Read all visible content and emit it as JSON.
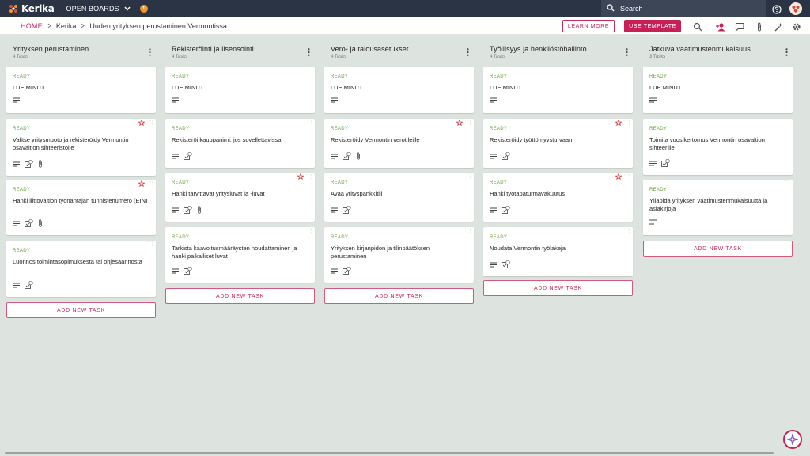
{
  "app": {
    "brand": "Kerika",
    "open_boards": "OPEN BOARDS",
    "notify_count": "1",
    "search_label": "Search"
  },
  "breadcrumb": {
    "home": "HOME",
    "workspace": "Kerika",
    "board": "Uuden yrityksen perustaminen Vermontissa"
  },
  "actions": {
    "learn_more": "LEARN MORE",
    "use_template": "USE TEMPLATE"
  },
  "add_task_label": "ADD NEW TASK",
  "columns": [
    {
      "title": "Yrityksen perustaminen",
      "count": "4 Tasks",
      "cards": [
        {
          "status": "READY",
          "title": "LUE MINUT"
        },
        {
          "status": "READY",
          "title": "Valitse yritysmuoto ja rekisteröidy Vermontin osavaltion sihteeristölle"
        },
        {
          "status": "READY",
          "title": "Hanki liittovaltion työnantajan tunnistenumero (EIN)"
        },
        {
          "status": "READY",
          "title": "Luonnos toimintasopimuksesta tai ohjesäännöstä"
        }
      ]
    },
    {
      "title": "Rekisteröinti ja lisensointi",
      "count": "4 Tasks",
      "cards": [
        {
          "status": "READY",
          "title": "LUE MINUT"
        },
        {
          "status": "READY",
          "title": "Rekisteröi kauppanimi, jos sovellettavissa"
        },
        {
          "status": "READY",
          "title": "Hanki tarvittavat yritysluvat ja -luvat"
        },
        {
          "status": "READY",
          "title": "Tarkista kaavoitusmääräysten noudattaminen ja hanki paikalliset luvat"
        }
      ]
    },
    {
      "title": "Vero- ja talousasetukset",
      "count": "4 Tasks",
      "cards": [
        {
          "status": "READY",
          "title": "LUE MINUT"
        },
        {
          "status": "READY",
          "title": "Rekisteröidy Vermontin verotileille"
        },
        {
          "status": "READY",
          "title": "Avaa yrityspankkitili"
        },
        {
          "status": "READY",
          "title": "Yrityksen kirjanpidon ja tilinpäätöksen perustaminen"
        }
      ]
    },
    {
      "title": "Työllisyys ja henkilöstöhallinto",
      "count": "4 Tasks",
      "cards": [
        {
          "status": "READY",
          "title": "LUE MINUT"
        },
        {
          "status": "READY",
          "title": "Rekisteröidy työttömyysturvaan"
        },
        {
          "status": "READY",
          "title": "Hanki työtapaturmavakuutus"
        },
        {
          "status": "READY",
          "title": "Noudata Vermontin työlakeja"
        }
      ]
    },
    {
      "title": "Jatkuva vaatimustenmukaisuus",
      "count": "3 Tasks",
      "cards": [
        {
          "status": "READY",
          "title": "LUE MINUT"
        },
        {
          "status": "READY",
          "title": "Toimita vuosikertomus Vermontin osavaltion sihteerille"
        },
        {
          "status": "READY",
          "title": "Ylläpidä yrityksen vaatimustenmukaisuutta ja asiakirjoja"
        }
      ]
    }
  ]
}
